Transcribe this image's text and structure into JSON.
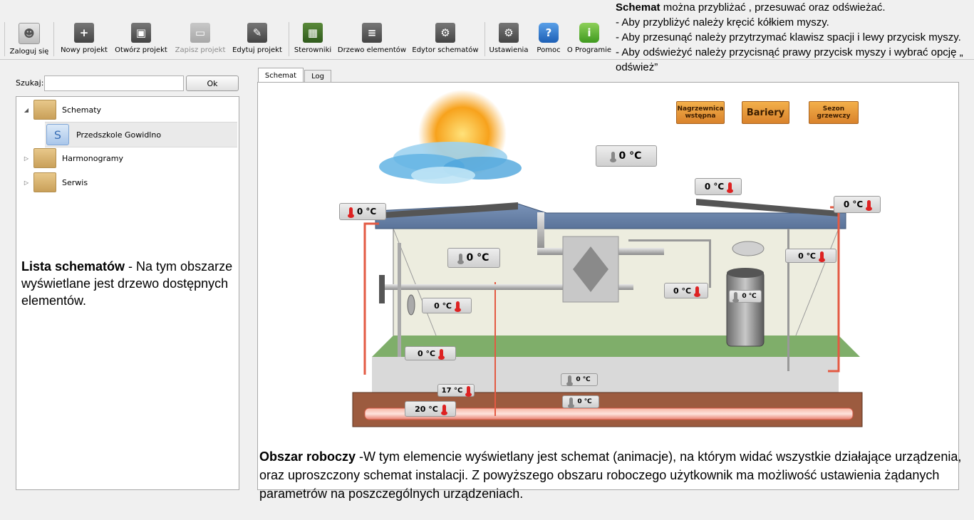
{
  "toolbar": {
    "items": [
      {
        "label": "Zaloguj się",
        "icon": "user-icon",
        "disabled": false
      },
      {
        "label": "Nowy projekt",
        "icon": "new-project-icon",
        "disabled": false
      },
      {
        "label": "Otwórz projekt",
        "icon": "open-project-icon",
        "disabled": false
      },
      {
        "label": "Zapisz projekt",
        "icon": "save-project-icon",
        "disabled": true
      },
      {
        "label": "Edytuj projekt",
        "icon": "edit-project-icon",
        "disabled": false
      },
      {
        "label": "Sterowniki",
        "icon": "controller-icon",
        "disabled": false
      },
      {
        "label": "Drzewo elementów",
        "icon": "element-tree-icon",
        "disabled": false
      },
      {
        "label": "Edytor schematów",
        "icon": "schema-editor-icon",
        "disabled": false
      },
      {
        "label": "Ustawienia",
        "icon": "settings-icon",
        "disabled": false
      },
      {
        "label": "Pomoc",
        "icon": "help-icon",
        "disabled": false
      },
      {
        "label": "O Programie",
        "icon": "info-icon",
        "disabled": false
      }
    ]
  },
  "search": {
    "label": "Szukaj:",
    "value": "",
    "button": "Ok"
  },
  "tree": {
    "items": [
      {
        "label": "Schematy",
        "expanded": true
      },
      {
        "label": "Przedszkole Gowidlno"
      },
      {
        "label": "Harmonogramy",
        "expanded": false
      },
      {
        "label": "Serwis",
        "expanded": false
      }
    ]
  },
  "tabs": {
    "schemat": "Schemat",
    "log": "Log"
  },
  "callouts": {
    "top_bold": "Schemat",
    "top_rest": " można przybliżać , przesuwać oraz odświeżać.",
    "top_line2": "- Aby przybliżyć należy kręcić kółkiem myszy.",
    "top_line3": "- Aby przesunąć należy przytrzymać klawisz spacji i lewy przycisk myszy.",
    "top_line4": "- Aby odświeżyć należy przycisnąć prawy przycisk myszy i wybrać opcję „ odśwież”",
    "left_bold": "Lista schematów",
    "left_rest": " - Na tym obszarze wyświetlane jest drzewo dostępnych elementów.",
    "bottom_bold": "Obszar roboczy",
    "bottom_rest": " -W tym elemencie wyświetlany jest schemat (animacje), na którym widać wszystkie działające urządzenia, oraz uproszczony schemat instalacji. Z powyższego obszaru roboczego użytkownik ma możliwość ustawienia żądanych parametrów na poszczególnych urządzeniach."
  },
  "schema_buttons": {
    "nagrzewnica": "Nagrzewnica wstępna",
    "bariery": "Bariery",
    "sezon": "Sezon grzewczy"
  },
  "temps": {
    "outdoor": "0 °C",
    "roof_left": "0 °C",
    "roof_center": "0 °C",
    "roof_right": "0 °C",
    "room_main": "0 °C",
    "heater_left": "0 ℃",
    "duct": "0 °C",
    "right_device": "0 ℃",
    "tank": "0 ℃",
    "floor": "0 °C",
    "ground1": "0 ℃",
    "ground2": "0 ℃",
    "supply": "17 °C",
    "return": "20 °C"
  }
}
